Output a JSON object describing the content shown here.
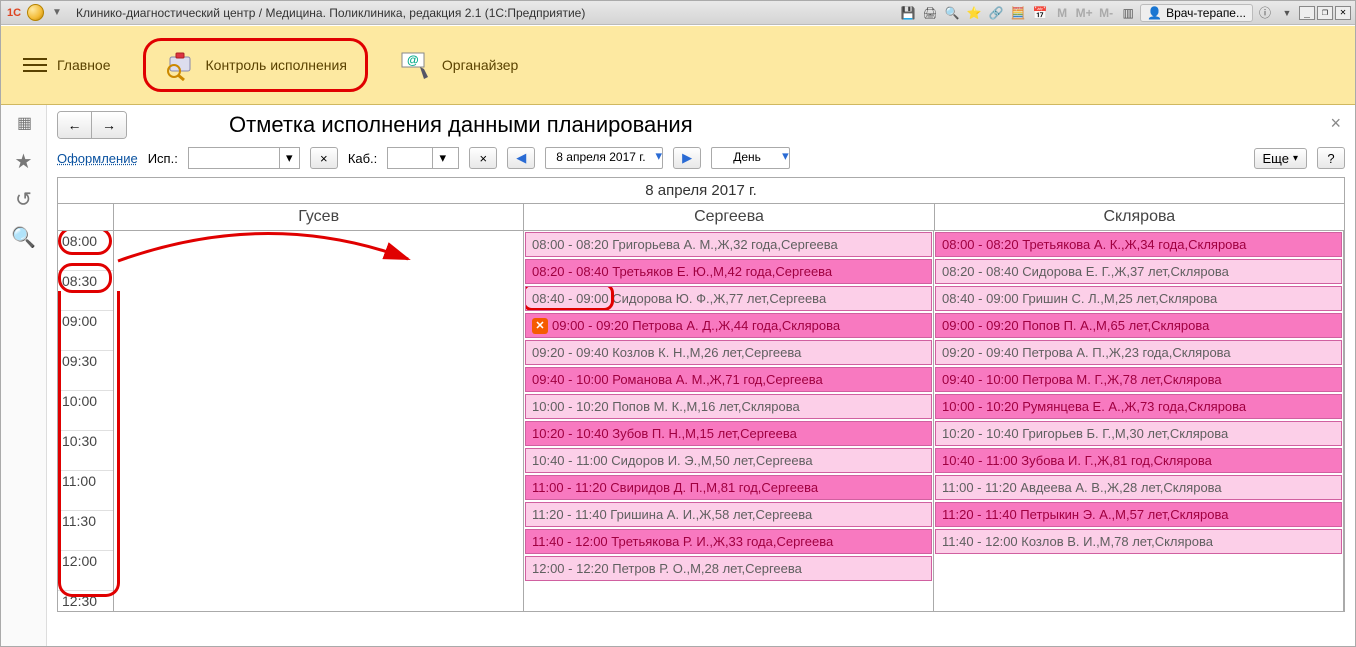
{
  "titlebar": {
    "text": "Клинико-диагностический центр / Медицина. Поликлиника, редакция 2.1  (1С:Предприятие)",
    "user": "Врач-терапе..."
  },
  "maintabs": {
    "main": "Главное",
    "control": "Контроль исполнения",
    "organizer": "Органайзер"
  },
  "page": {
    "title": "Отметка исполнения данными планирования"
  },
  "filter": {
    "design_link": "Оформление",
    "isp_label": "Исп.:",
    "kab_label": "Каб.:",
    "date_text": "8 апреля 2017 г.",
    "mode_text": "День",
    "more": "Еще",
    "help": "?"
  },
  "grid": {
    "date_header": "8 апреля 2017 г.",
    "doctors": [
      "Гусев",
      "Сергеева",
      "Склярова"
    ],
    "time_axis": [
      "08:00",
      "08:30",
      "09:00",
      "09:30",
      "10:00",
      "10:30",
      "11:00",
      "11:30",
      "12:00",
      "12:30"
    ],
    "sergeeva": [
      {
        "t": "08:00 - 08:20 Григорьева А. М.,Ж,32 года,Сергеева",
        "shade": "light"
      },
      {
        "t": "08:20 - 08:40 Третьяков Е. Ю.,М,42 года,Сергеева",
        "shade": "dark"
      },
      {
        "t": "08:40 - 09:00 Сидорова Ю. Ф.,Ж,77 лет,Сергеева",
        "shade": "light",
        "hl": true
      },
      {
        "t": "09:00 - 09:20 Петрова А. Д.,Ж,44 года,Склярова",
        "shade": "dark",
        "cancel": true
      },
      {
        "t": "09:20 - 09:40 Козлов К. Н.,М,26 лет,Сергеева",
        "shade": "light"
      },
      {
        "t": "09:40 - 10:00 Романова А. М.,Ж,71 год,Сергеева",
        "shade": "dark"
      },
      {
        "t": "10:00 - 10:20 Попов М. К.,М,16 лет,Склярова",
        "shade": "light"
      },
      {
        "t": "10:20 - 10:40 Зубов П. Н.,М,15 лет,Сергеева",
        "shade": "dark"
      },
      {
        "t": "10:40 - 11:00 Сидоров И. Э.,М,50 лет,Сергеева",
        "shade": "light"
      },
      {
        "t": "11:00 - 11:20 Свиридов Д. П.,М,81 год,Сергеева",
        "shade": "dark"
      },
      {
        "t": "11:20 - 11:40 Гришина А. И.,Ж,58 лет,Сергеева",
        "shade": "light"
      },
      {
        "t": "11:40 - 12:00 Третьякова Р. И.,Ж,33 года,Сергеева",
        "shade": "dark"
      },
      {
        "t": "12:00 - 12:20 Петров Р. О.,М,28 лет,Сергеева",
        "shade": "light"
      }
    ],
    "sklyarova": [
      {
        "t": "08:00 - 08:20 Третьякова А. К.,Ж,34 года,Склярова",
        "shade": "dark"
      },
      {
        "t": "08:20 - 08:40 Сидорова Е. Г.,Ж,37 лет,Склярова",
        "shade": "light"
      },
      {
        "t": "08:40 - 09:00 Гришин С. Л.,М,25 лет,Склярова",
        "shade": "light"
      },
      {
        "t": "09:00 - 09:20 Попов П. А.,М,65 лет,Склярова",
        "shade": "dark"
      },
      {
        "t": "09:20 - 09:40 Петрова А. П.,Ж,23 года,Склярова",
        "shade": "light"
      },
      {
        "t": "09:40 - 10:00 Петрова М. Г.,Ж,78 лет,Склярова",
        "shade": "dark"
      },
      {
        "t": "10:00 - 10:20 Румянцева Е. А.,Ж,73 года,Склярова",
        "shade": "dark"
      },
      {
        "t": "10:20 - 10:40 Григорьев Б. Г.,М,30 лет,Склярова",
        "shade": "light"
      },
      {
        "t": "10:40 - 11:00 Зубова И. Г.,Ж,81 год,Склярова",
        "shade": "dark"
      },
      {
        "t": "11:00 - 11:20 Авдеева А. В.,Ж,28 лет,Склярова",
        "shade": "light"
      },
      {
        "t": "11:20 - 11:40 Петрыкин Э. А.,М,57 лет,Склярова",
        "shade": "dark"
      },
      {
        "t": "11:40 - 12:00 Козлов В. И.,М,78 лет,Склярова",
        "shade": "light"
      }
    ]
  }
}
